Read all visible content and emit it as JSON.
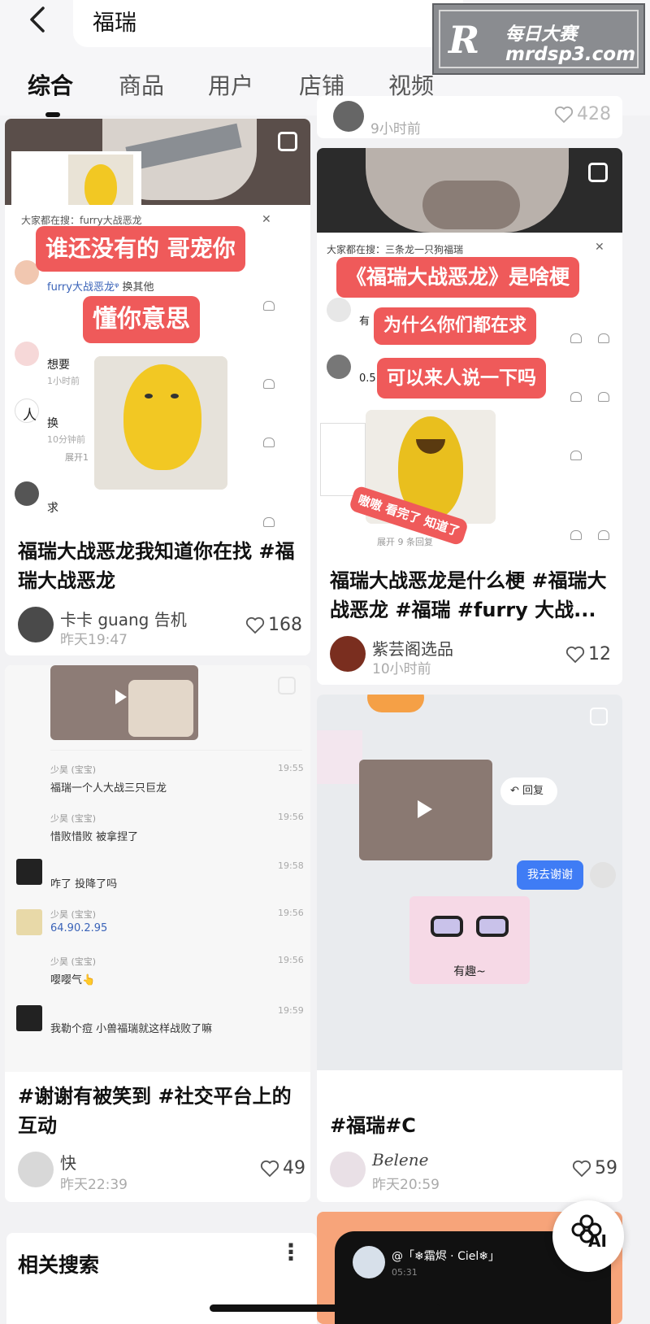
{
  "search": {
    "query": "福瑞"
  },
  "watermark": {
    "logo": "R",
    "line1": "每日大赛",
    "line2": "mrdsp3.com"
  },
  "tabs": [
    "综合",
    "商品",
    "用户",
    "店铺",
    "视频"
  ],
  "cards": {
    "c1": {
      "overlay_top": "大家都在搜：furry大战恶龙",
      "bubble1": "谁还没有的 哥宠你",
      "bubble2": "懂你意思",
      "comment_user": "furry大战恶龙",
      "comment_suffix": "换其他",
      "reply1": "想要",
      "reply2": "换",
      "reply3": "求",
      "meta1": "1小时前",
      "meta2": "10分钟前",
      "expand": "展开1",
      "title": "福瑞大战恶龙我知道你在找 #福瑞大战恶龙",
      "author": "卡卡 guang 告机",
      "time": "昨天19:47",
      "likes": "168"
    },
    "c2": {
      "time": "9小时前",
      "likes": "428",
      "overlay_top": "大家都在搜：三条龙一只狗福瑞",
      "bubble1": "《福瑞大战恶龙》是啥梗",
      "bubble2": "为什么你们都在求",
      "bubble3": "可以来人说一下吗",
      "sticker": "嗷嗷 看完了 知道了",
      "expand": "展开 9 条回复",
      "reply1": "有",
      "reply2": "0.5",
      "title": "福瑞大战恶龙是什么梗 #福瑞大战恶龙 #福瑞 #furry 大战...",
      "author": "紫芸阁选品",
      "time2": "10小时前",
      "likes2": "12"
    },
    "c3": {
      "chat": [
        {
          "name": "少昊 (宝宝)",
          "text": "福瑞一个人大战三只巨龙",
          "time": "19:55"
        },
        {
          "name": "少昊 (宝宝)",
          "text": "惜败惜败 被拿捏了",
          "time": "19:56"
        },
        {
          "name": "",
          "text": "咋了 投降了吗",
          "time": "19:58"
        },
        {
          "name": "少昊 (宝宝)",
          "text": "64.90.2.95",
          "time": "19:56"
        },
        {
          "name": "少昊 (宝宝)",
          "text": "嘤嘤气👆",
          "time": "19:56"
        },
        {
          "name": "",
          "text": "我勒个痘 小兽福瑞就这样战败了嘛",
          "time": "19:59"
        }
      ],
      "title": "#谢谢有被笑到 #社交平台上的互动",
      "author": "快",
      "time": "昨天22:39",
      "likes": "49"
    },
    "c4": {
      "reply_label": "回复",
      "blue_bubble": "我去谢谢",
      "sticker_caption": "有趣~",
      "title": "#福瑞#C",
      "author": "Belene",
      "time": "昨天20:59",
      "likes": "59"
    },
    "c5": {
      "chat_user": "@「❄霜烬 · Ciel❄」",
      "chat_time": "05:31"
    }
  },
  "related": {
    "title": "相关搜索"
  },
  "ai_label": "AI",
  "colors": {
    "accent_red": "#ef5a5a",
    "blue_bubble": "#3f7cf5",
    "orange_card": "#f7a47a"
  }
}
